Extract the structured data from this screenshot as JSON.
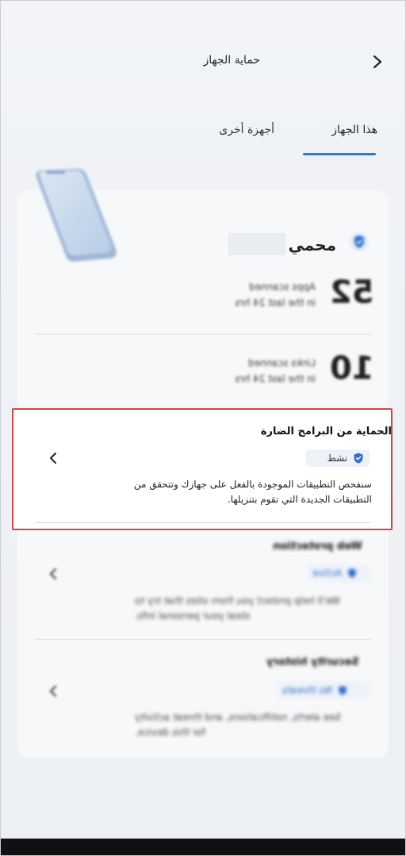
{
  "header": {
    "title": "حماية الجهاز"
  },
  "tabs": [
    {
      "label": "هذا الجهاز",
      "active": true
    },
    {
      "label": "أجهزة أخرى",
      "active": false
    }
  ],
  "device": {
    "name": "محمي"
  },
  "stats": [
    {
      "value": "52",
      "line1": "Apps scanned",
      "line2": "in the last 24 hrs"
    },
    {
      "value": "10",
      "line1": "Links scanned",
      "line2": "in the last 24 hrs"
    }
  ],
  "sections": {
    "malware": {
      "title": "الحماية من البرامج الضارة",
      "status": "نشط",
      "desc_line1": "سنفحص التطبيقات الموجودة بالفعل على جهازك وتتحقق من",
      "desc_line2": "التطبيقات الجديدة التي تقوم بتنزيلها."
    },
    "web": {
      "title": "Web protection",
      "status": "Active",
      "desc_line1": "We'll help protect you from sites that try to",
      "desc_line2": "steal your personal info."
    },
    "history": {
      "title": "Security history",
      "status": "No threats",
      "desc_line1": "See alerts, notifications, and threat activity",
      "desc_line2": "for this device."
    }
  },
  "colors": {
    "accent": "#2e7bc6",
    "highlight_border": "#d64545",
    "shield": "#2f6fd0"
  }
}
